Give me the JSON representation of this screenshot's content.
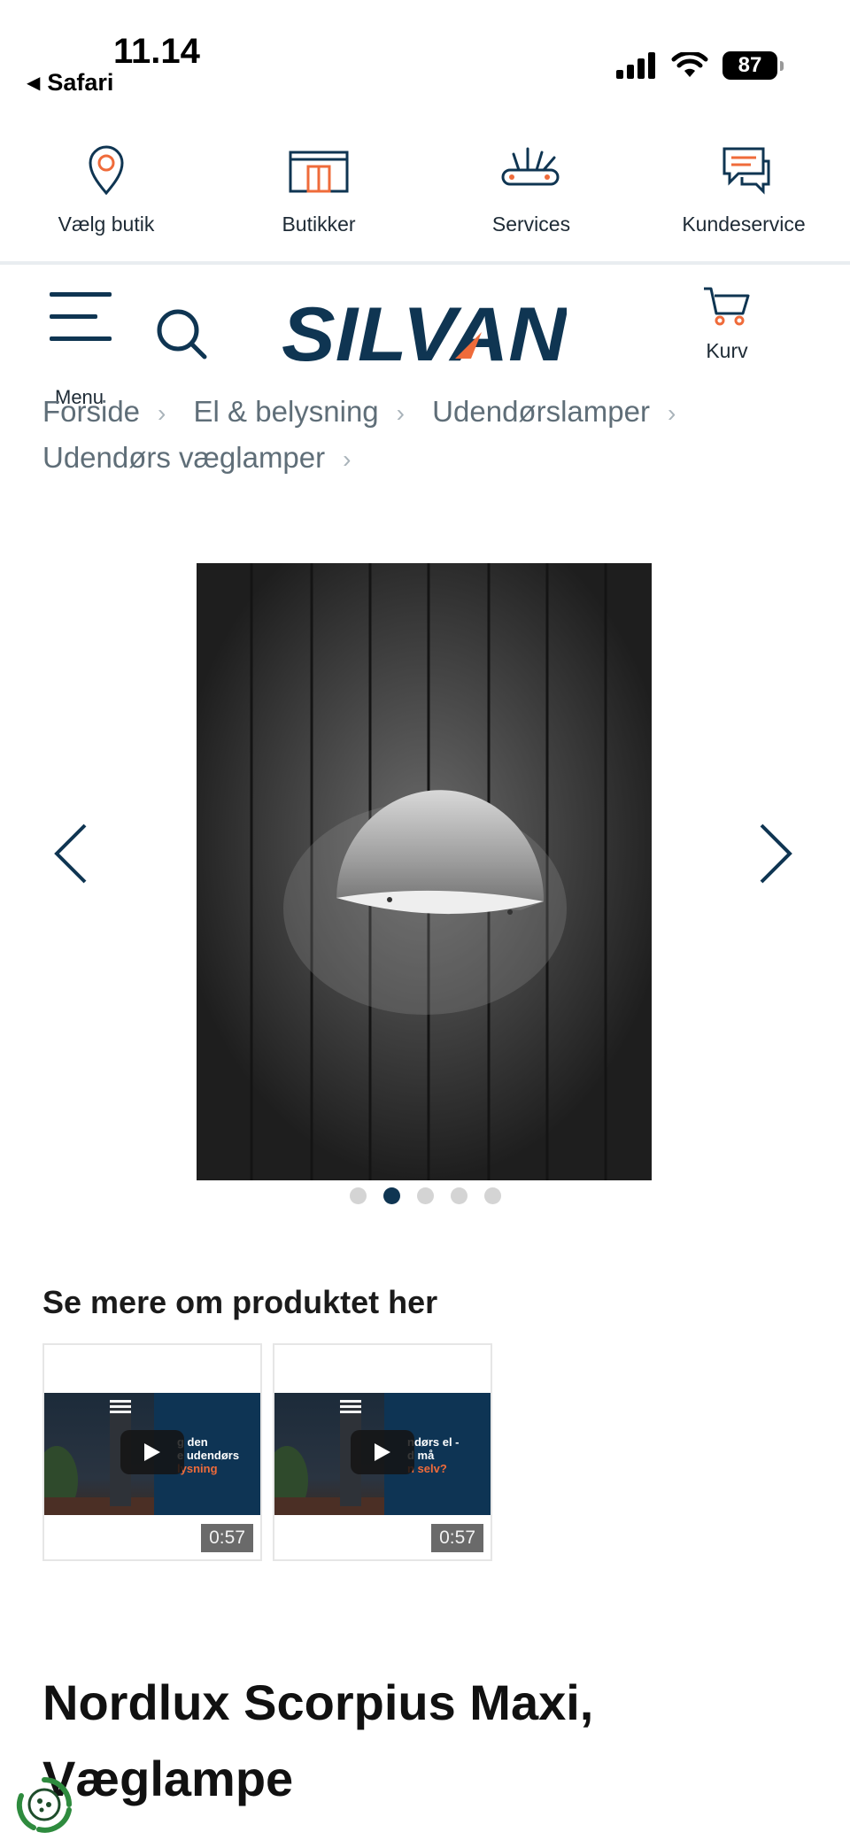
{
  "status_bar": {
    "time": "11.14",
    "back_label": "Safari",
    "battery": "87"
  },
  "util_nav": [
    {
      "label": "Vælg butik",
      "icon": "location-pin-icon"
    },
    {
      "label": "Butikker",
      "icon": "store-icon"
    },
    {
      "label": "Services",
      "icon": "services-tools-icon"
    },
    {
      "label": "Kundeservice",
      "icon": "chat-bubbles-icon"
    }
  ],
  "header": {
    "menu_label": "Menu",
    "logo_text": "SILVAN",
    "cart_label": "Kurv"
  },
  "breadcrumb": [
    "Forside",
    "El & belysning",
    "Udendørslamper",
    "Udendørs væglamper"
  ],
  "carousel": {
    "dot_count": 5,
    "active_index": 1
  },
  "videos": {
    "title": "Se mere om produktet her",
    "items": [
      {
        "overlay_line1": "g den",
        "overlay_line2": "e udendørs",
        "overlay_line3": "lysning",
        "duration": "0:57"
      },
      {
        "overlay_line1": "ndørs el -",
        "overlay_line2": "d må",
        "overlay_line3": "n selv?",
        "duration": "0:57"
      }
    ]
  },
  "product": {
    "title": "Nordlux Scorpius Maxi, Væglampe"
  },
  "colors": {
    "brand_navy": "#0f3552",
    "brand_orange": "#ef6b3a"
  }
}
